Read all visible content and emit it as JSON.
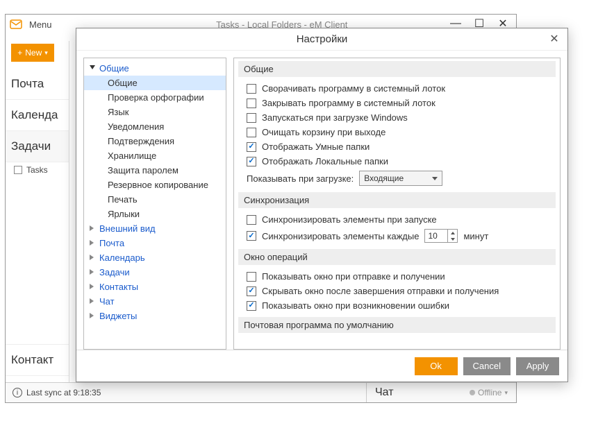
{
  "main": {
    "menu_label": "Menu",
    "window_title": "Tasks - Local Folders - eM Client",
    "new_button": "New",
    "nav": {
      "mail": "Почта",
      "calendar": "Календа",
      "tasks": "Задачи",
      "tasks_sub": "Tasks",
      "contacts": "Контакт"
    },
    "status": "Last sync at 9:18:35",
    "chat_label": "Чат",
    "chat_status": "Offline"
  },
  "dialog": {
    "title": "Настройки",
    "tree": {
      "general": "Общие",
      "general_children": [
        "Общие",
        "Проверка орфографии",
        "Язык",
        "Уведомления",
        "Подтверждения",
        "Хранилище",
        "Защита паролем",
        "Резервное копирование",
        "Печать",
        "Ярлыки"
      ],
      "appearance": "Внешний вид",
      "mail": "Почта",
      "calendar": "Календарь",
      "tasks": "Задачи",
      "contacts": "Контакты",
      "chat": "Чат",
      "widgets": "Виджеты"
    },
    "sections": {
      "general": {
        "header": "Общие",
        "minimize_tray": "Сворачивать программу в системный лоток",
        "close_tray": "Закрывать программу в системный лоток",
        "run_startup": "Запускаться при загрузке Windows",
        "empty_trash": "Очищать корзину при выходе",
        "show_smart": "Отображать Умные папки",
        "show_local": "Отображать Локальные папки",
        "show_on_startup_label": "Показывать при загрузке:",
        "show_on_startup_value": "Входящие"
      },
      "sync": {
        "header": "Синхронизация",
        "sync_on_start": "Синхронизировать элементы при запуске",
        "sync_every": "Синхронизировать элементы каждые",
        "sync_value": "10",
        "sync_unit": "минут"
      },
      "opwin": {
        "header": "Окно операций",
        "show_sendrecv": "Показывать окно при отправке и получении",
        "hide_after": "Скрывать окно после завершения отправки и получения",
        "show_on_error": "Показывать окно при возникновении ошибки"
      },
      "default_mail": {
        "header": "Почтовая программа по умолчанию"
      }
    },
    "buttons": {
      "ok": "Ok",
      "cancel": "Cancel",
      "apply": "Apply"
    }
  }
}
